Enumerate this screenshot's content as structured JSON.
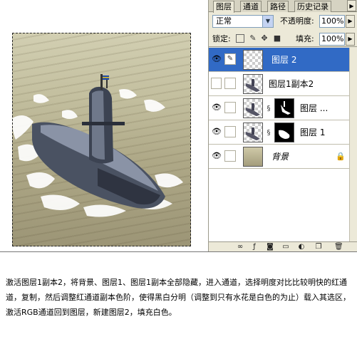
{
  "tabs": [
    "图层",
    "通道",
    "路径",
    "历史记录"
  ],
  "blend_mode": "正常",
  "opacity_label": "不透明度:",
  "opacity_value": "100%",
  "lock_label": "锁定:",
  "fill_label": "填充:",
  "fill_value": "100%",
  "layers": [
    {
      "name": "图层 2",
      "visible": true,
      "selected": true
    },
    {
      "name": "图层1副本2",
      "visible": false,
      "selected": false
    },
    {
      "name": "图层 ...",
      "visible": true,
      "selected": false
    },
    {
      "name": "图层 1",
      "visible": true,
      "selected": false
    },
    {
      "name": "背景",
      "visible": true,
      "selected": false,
      "locked": true
    }
  ],
  "caption": "激活图层1副本2，将背景、图层1、图层1副本全部隐藏，进入通道，选择明度对比比较明快的红通道，复制，然后调整红通道副本色阶，使得黑白分明（调整到只有水花是白色的为止）载入其选区，激活RGB通道回到图层，新建图层2，填充白色。",
  "colors": {
    "selection": "#316ac5",
    "panel_bg": "#ece9d8",
    "input_border": "#7f9db9"
  }
}
